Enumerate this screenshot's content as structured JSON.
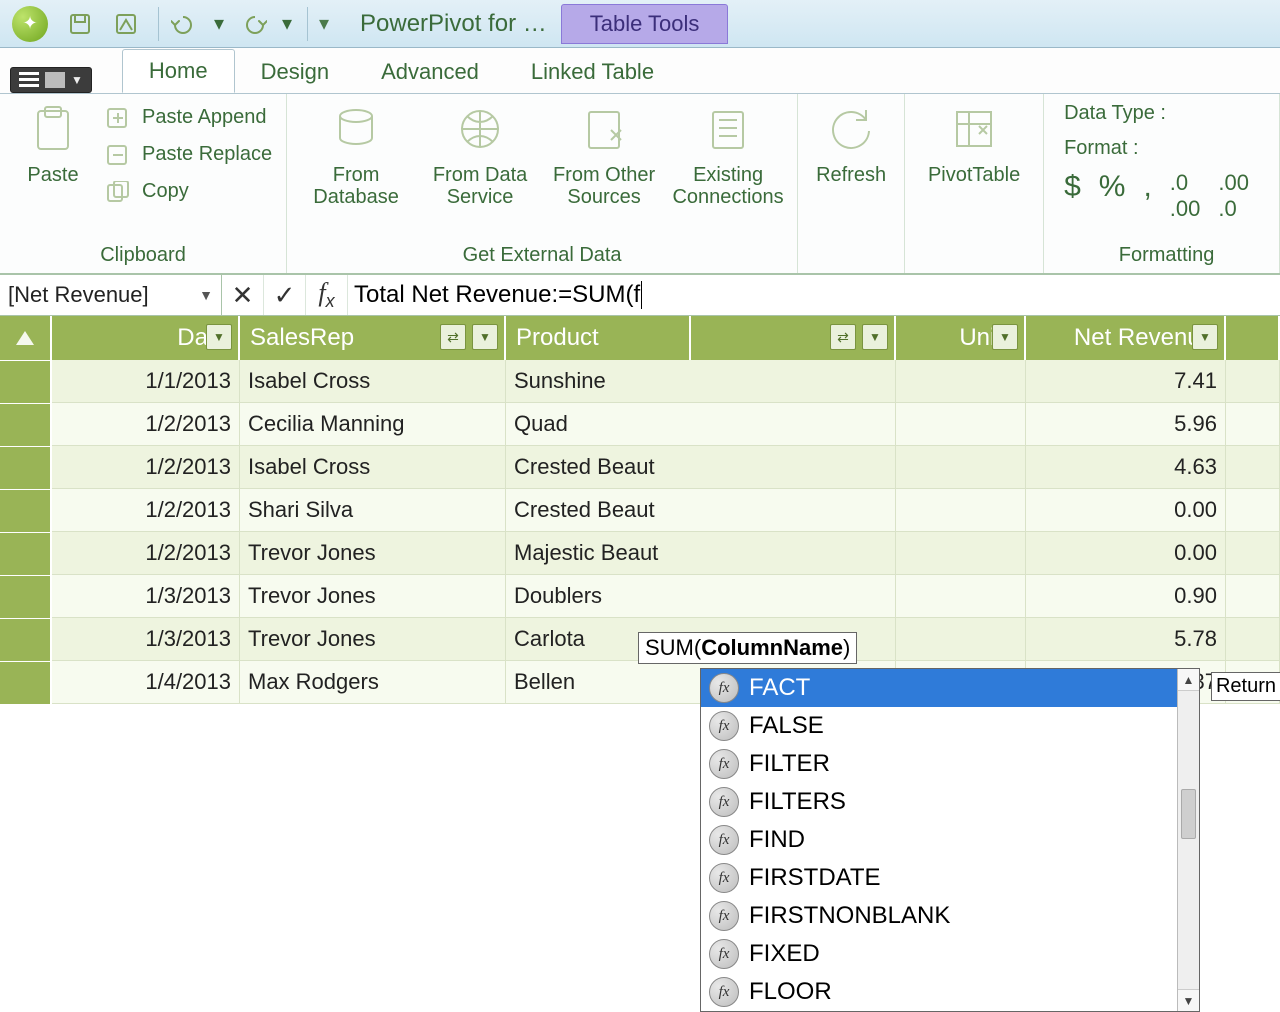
{
  "title": {
    "app": "PowerPivot for …",
    "context_tab": "Table Tools"
  },
  "tabs": {
    "home": "Home",
    "design": "Design",
    "advanced": "Advanced",
    "linked": "Linked Table"
  },
  "ribbon": {
    "clipboard": {
      "paste": "Paste",
      "paste_append": "Paste Append",
      "paste_replace": "Paste Replace",
      "copy": "Copy",
      "label": "Clipboard"
    },
    "get_data": {
      "from_db": "From Database",
      "from_ds": "From Data Service",
      "from_other": "From Other Sources",
      "existing": "Existing Connections",
      "label": "Get External Data"
    },
    "refresh": "Refresh",
    "pivot": "PivotTable",
    "formatting": {
      "data_type": "Data Type :",
      "format": "Format :",
      "label": "Formatting"
    }
  },
  "formula_bar": {
    "name_box": "[Net Revenue]",
    "formula": "Total Net Revenue:=SUM(f",
    "tooltip_prefix": "SUM(",
    "tooltip_arg": "ColumnName",
    "tooltip_suffix": ")",
    "return_hint": "Return"
  },
  "columns": {
    "date": "Date",
    "rep": "SalesRep",
    "product": "Product",
    "units": "Units",
    "rev": "Net Revenue"
  },
  "rows": [
    {
      "date": "1/1/2013",
      "rep": "Isabel Cross",
      "product": "Sunshine",
      "rev": "7.41"
    },
    {
      "date": "1/2/2013",
      "rep": "Cecilia Manning",
      "product": "Quad",
      "rev": "5.96"
    },
    {
      "date": "1/2/2013",
      "rep": "Isabel Cross",
      "product": "Crested Beaut",
      "rev": "4.63"
    },
    {
      "date": "1/2/2013",
      "rep": "Shari Silva",
      "product": "Crested Beaut",
      "rev": "0.00"
    },
    {
      "date": "1/2/2013",
      "rep": "Trevor Jones",
      "product": "Majestic Beaut",
      "rev": "0.00"
    },
    {
      "date": "1/3/2013",
      "rep": "Trevor Jones",
      "product": "Doublers",
      "rev": "0.90"
    },
    {
      "date": "1/3/2013",
      "rep": "Trevor Jones",
      "product": "Carlota",
      "rev": "5.78"
    },
    {
      "date": "1/4/2013",
      "rep": "Max Rodgers",
      "product": "Bellen",
      "rev": "7.37"
    }
  ],
  "autocomplete": {
    "selected_index": 0,
    "items": [
      "FACT",
      "FALSE",
      "FILTER",
      "FILTERS",
      "FIND",
      "FIRSTDATE",
      "FIRSTNONBLANK",
      "FIXED",
      "FLOOR"
    ]
  }
}
